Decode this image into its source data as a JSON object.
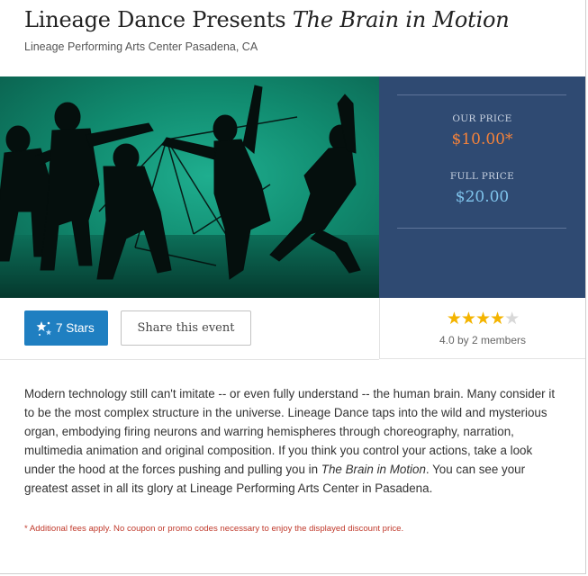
{
  "event": {
    "title_prefix": "Lineage Dance Presents ",
    "title_show": "The Brain in Motion",
    "venue": "Lineage Performing Arts Center Pasadena, CA"
  },
  "pricing": {
    "our_label": "OUR PRICE",
    "our_value": "$10.00*",
    "full_label": "FULL PRICE",
    "full_value": "$20.00",
    "panel_color": "#2f4a72",
    "our_color": "#f4823a",
    "full_color": "#7fc4ec"
  },
  "actions": {
    "stars_label": "7 Stars",
    "stars_icon": "sparkle-stars-icon",
    "share_label": "Share this event",
    "accent": "#1f7fc1"
  },
  "rating": {
    "value": 4.0,
    "max": 5,
    "text": "4.0 by 2 members"
  },
  "description": {
    "part1": "Modern technology still can't imitate -- or even fully understand -- the human brain. Many consider it to be the most complex structure in the universe. Lineage Dance taps into the wild and mysterious organ, embodying firing neurons and warring hemispheres through choreography, narration, multimedia animation and original composition. If you think you control your actions, take a look under the hood at the forces pushing and pulling you in ",
    "italic": "The Brain in Motion",
    "part2": ". You can see your greatest asset in all its glory at Lineage Performing Arts Center in Pasadena."
  },
  "footnote": "* Additional fees apply. No coupon or promo codes necessary to enjoy the displayed discount price."
}
